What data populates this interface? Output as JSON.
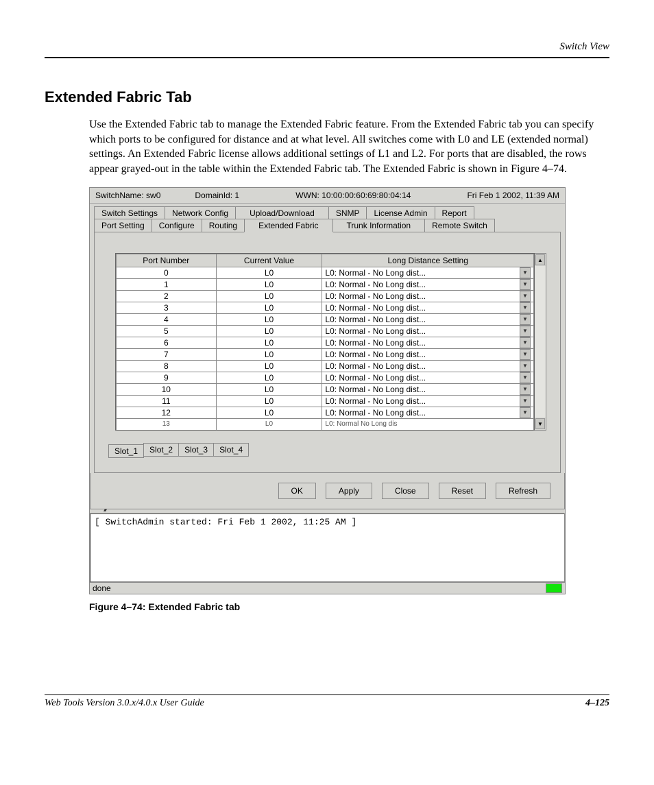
{
  "header": {
    "section": "Switch View"
  },
  "title": "Extended Fabric Tab",
  "paragraph": "Use the Extended Fabric tab to manage the Extended Fabric feature. From the Extended Fabric tab you can specify which ports to be configured for distance and at what level. All switches come with L0 and LE (extended normal) settings. An Extended Fabric license allows additional settings of L1 and L2. For ports that are disabled, the rows appear grayed-out in the table within the Extended Fabric tab. The Extended Fabric is shown in Figure 4–74.",
  "app": {
    "switch_name_label": "SwitchName:",
    "switch_name": "sw0",
    "domain_label": "DomainId:",
    "domain": "1",
    "wwn_label": "WWN:",
    "wwn": "10:00:00:60:69:80:04:14",
    "timestamp": "Fri Feb 1  2002, 11:39 AM",
    "tabs_row1": [
      "Switch Settings",
      "Network Config",
      "Upload/Download",
      "SNMP",
      "License Admin",
      "Report"
    ],
    "tabs_row2": [
      "Port Setting",
      "Configure",
      "Routing",
      "Extended Fabric",
      "Trunk Information",
      "Remote Switch"
    ],
    "active_tab": "Extended Fabric",
    "columns": [
      "Port Number",
      "Current Value",
      "Long Distance Setting"
    ],
    "rows": [
      {
        "port": "0",
        "value": "L0",
        "setting": "L0: Normal - No Long dist..."
      },
      {
        "port": "1",
        "value": "L0",
        "setting": "L0: Normal - No Long dist..."
      },
      {
        "port": "2",
        "value": "L0",
        "setting": "L0: Normal - No Long dist..."
      },
      {
        "port": "3",
        "value": "L0",
        "setting": "L0: Normal - No Long dist..."
      },
      {
        "port": "4",
        "value": "L0",
        "setting": "L0: Normal - No Long dist..."
      },
      {
        "port": "5",
        "value": "L0",
        "setting": "L0: Normal - No Long dist..."
      },
      {
        "port": "6",
        "value": "L0",
        "setting": "L0: Normal - No Long dist..."
      },
      {
        "port": "7",
        "value": "L0",
        "setting": "L0: Normal - No Long dist..."
      },
      {
        "port": "8",
        "value": "L0",
        "setting": "L0: Normal - No Long dist..."
      },
      {
        "port": "9",
        "value": "L0",
        "setting": "L0: Normal - No Long dist..."
      },
      {
        "port": "10",
        "value": "L0",
        "setting": "L0: Normal - No Long dist..."
      },
      {
        "port": "11",
        "value": "L0",
        "setting": "L0: Normal - No Long dist..."
      },
      {
        "port": "12",
        "value": "L0",
        "setting": "L0: Normal - No Long dist..."
      }
    ],
    "truncated": {
      "port": "13",
      "value": "L0",
      "setting": "L0: Normal   No Long dist"
    },
    "slot_tabs": [
      "Slot_1",
      "Slot_2",
      "Slot_3",
      "Slot_4"
    ],
    "active_slot": "Slot_1",
    "buttons": [
      "OK",
      "Apply",
      "Close",
      "Reset",
      "Refresh"
    ],
    "console": "[ SwitchAdmin started: Fri Feb 1  2002, 11:25 AM ]",
    "status": "done"
  },
  "figure_caption": "Figure 4–74:  Extended Fabric tab",
  "footer": {
    "left": "Web Tools Version 3.0.x/4.0.x User Guide",
    "right": "4–125"
  }
}
